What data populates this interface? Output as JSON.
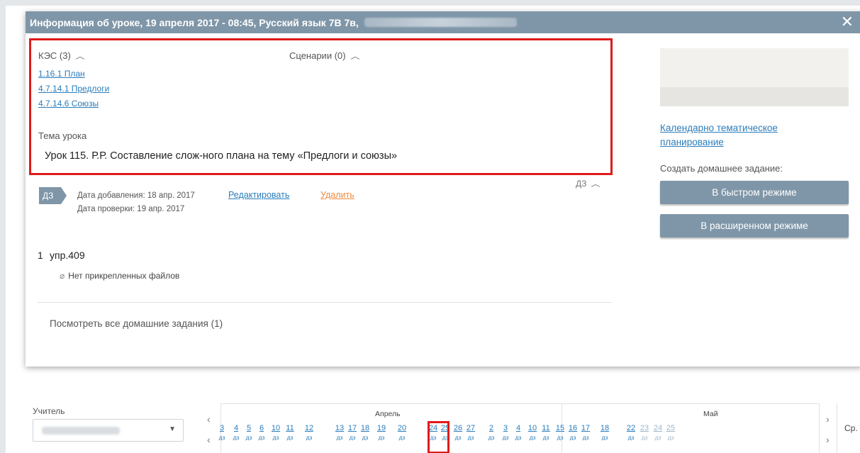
{
  "modal": {
    "title": "Информация об уроке, 19 апреля 2017 - 08:45, Русский язык 7В 7в,",
    "close_label": "✕"
  },
  "kes": {
    "title": "КЭС (3)",
    "items": [
      "1.16.1 План",
      "4.7.14.1 Предлоги",
      "4.7.14.6 Союзы"
    ]
  },
  "scenarios": {
    "title": "Сценарии (0)"
  },
  "topic": {
    "label": "Тема урока",
    "text": "Урок 115. Р.Р. Составление слож-ного плана на тему «Предлоги и союзы»"
  },
  "homework": {
    "badge": "ДЗ",
    "toggle": "ДЗ",
    "date_added": "Дата добавления: 18 апр. 2017",
    "date_check": "Дата проверки: 19 апр. 2017",
    "edit_label": "Редактировать",
    "delete_label": "Удалить",
    "item_number": "1",
    "item_text": "упр.409",
    "no_files": "Нет прикрепленных файлов",
    "view_all": "Посмотреть все домашние задания (1)"
  },
  "sidebar": {
    "calendar_link": "Календарно тематическое планирование",
    "create_label": "Создать домашнее задание:",
    "fast_button": "В быстром режиме",
    "extended_button": "В расширенном режиме"
  },
  "scheduler": {
    "teacher_label": "Учитель",
    "months": [
      "Апрель",
      "Май"
    ],
    "days_april": [
      "3",
      "4",
      "5",
      "6",
      "10",
      "11",
      "12",
      "13",
      "17",
      "18",
      "19",
      "20",
      "24",
      "25",
      "26",
      "27"
    ],
    "days_may": [
      "2",
      "3",
      "4",
      "10",
      "11",
      "15",
      "16",
      "17",
      "18",
      "22",
      "23",
      "24",
      "25"
    ],
    "dz_label": "дз",
    "right_label": "Ср."
  }
}
